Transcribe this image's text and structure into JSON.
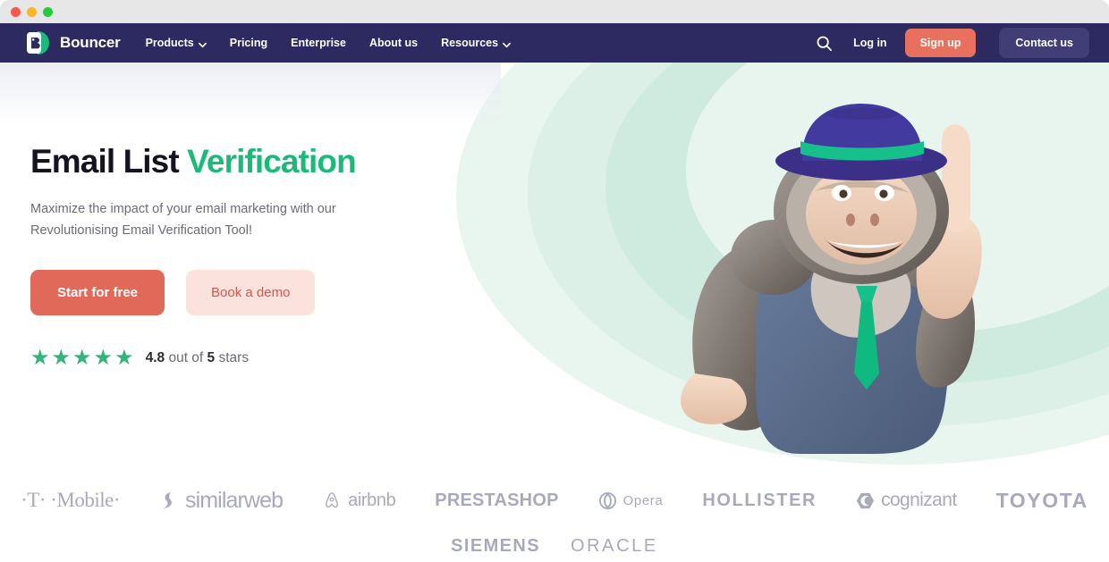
{
  "window": {
    "traffic_lights": [
      "close",
      "minimize",
      "zoom"
    ],
    "colors": {
      "nav_bg": "#2c2a60",
      "accent_green": "#1db97a",
      "accent_coral": "#e8705f",
      "secondary_coral_bg": "#fbe2dd",
      "hero_mint": "#cfeade",
      "logo_grey": "#a9a9bd"
    }
  },
  "nav": {
    "brand": "Bouncer",
    "brand_icon": "bouncer-logo-icon",
    "links": [
      {
        "label": "Products",
        "has_dropdown": true,
        "icon": "chevron-down-icon"
      },
      {
        "label": "Pricing",
        "has_dropdown": false
      },
      {
        "label": "Enterprise",
        "has_dropdown": false
      },
      {
        "label": "About us",
        "has_dropdown": false
      },
      {
        "label": "Resources",
        "has_dropdown": true,
        "icon": "chevron-down-icon"
      }
    ],
    "search_icon": "search-icon",
    "login_label": "Log in",
    "signup_label": "Sign up",
    "contact_label": "Contact us"
  },
  "hero": {
    "title_plain": "Email List ",
    "title_accent": "Verification",
    "subtitle": "Maximize the impact of your email marketing with our Revolutionising Email Verification Tool!",
    "primary_cta": "Start for free",
    "secondary_cta": "Book a demo",
    "rating": {
      "stars_glyph": "★★★★★",
      "star_count": 5,
      "score": "4.8",
      "middle_text": " out of ",
      "max": "5",
      "suffix": " stars"
    },
    "mascot": {
      "name": "gorilla-mascot",
      "description": "3D gorilla wearing purple fedora with green band, blue vest and green tie, pointing index finger upward"
    }
  },
  "logos": {
    "row1": [
      {
        "name": "t-mobile",
        "text": "·T· ·Mobile·"
      },
      {
        "name": "similarweb",
        "text": "similarweb"
      },
      {
        "name": "airbnb",
        "text": "airbnb"
      },
      {
        "name": "prestashop",
        "text": "PRESTASHOP"
      },
      {
        "name": "opera",
        "text": "Opera"
      },
      {
        "name": "hollister",
        "text": "HOLLISTER"
      },
      {
        "name": "cognizant",
        "text": "cognizant"
      },
      {
        "name": "toyota",
        "text": "TOYOTA"
      }
    ],
    "row2": [
      {
        "name": "siemens",
        "text": "SIEMENS"
      },
      {
        "name": "oracle",
        "text": "ORACLE"
      }
    ]
  }
}
